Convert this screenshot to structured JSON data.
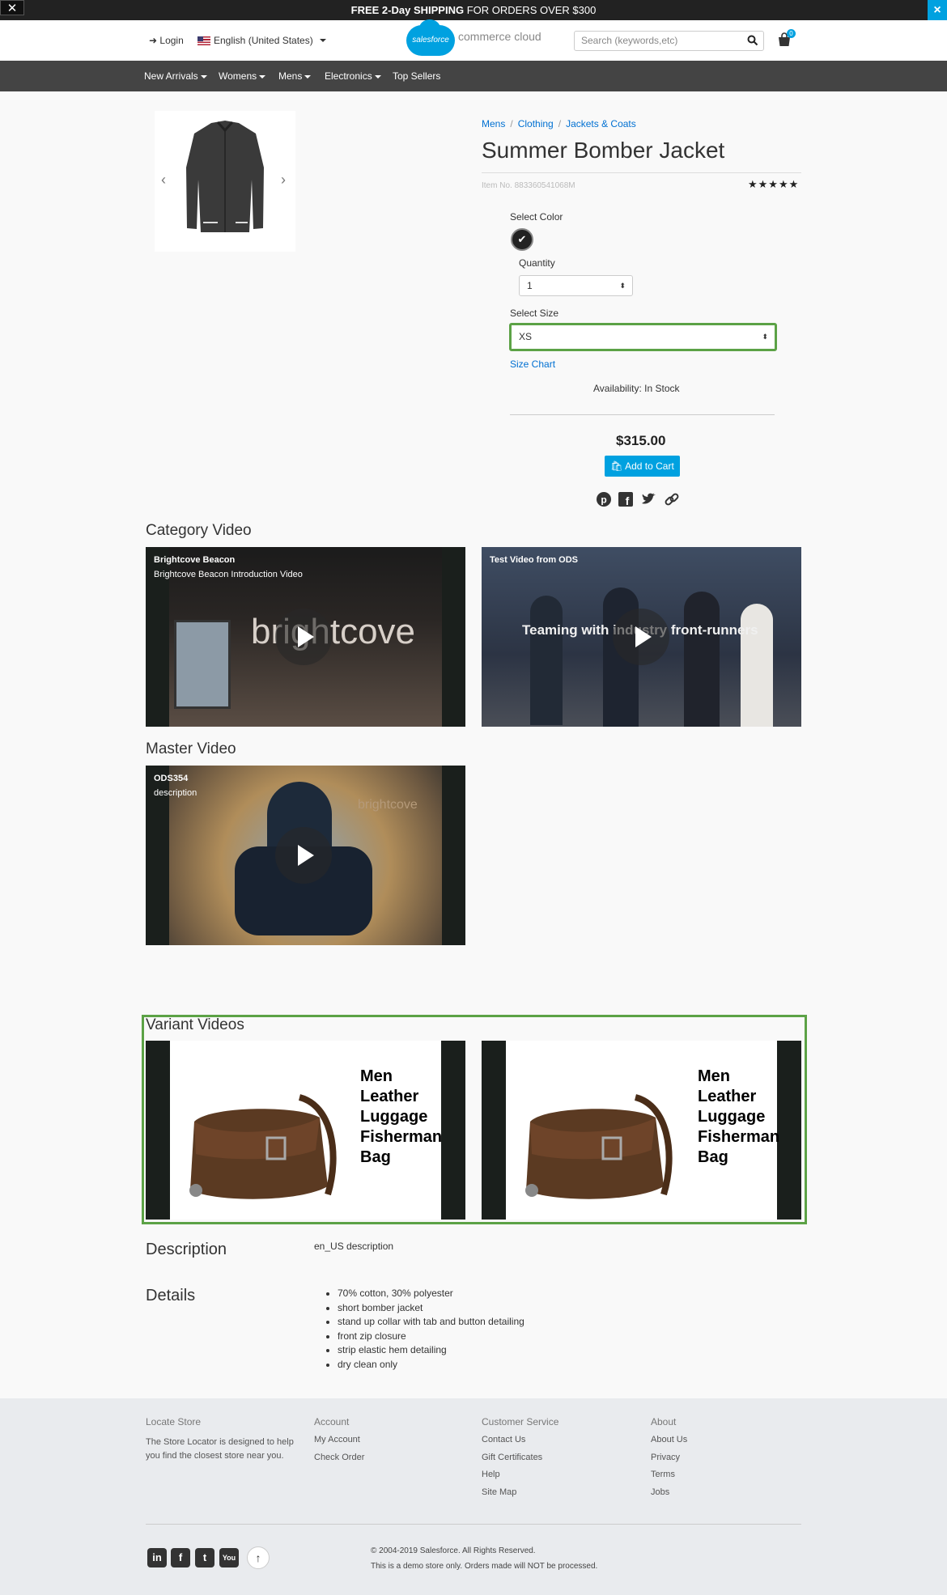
{
  "promo": {
    "bold": "FREE 2-Day SHIPPING",
    "rest": " FOR ORDERS OVER $300",
    "close": "×"
  },
  "header": {
    "login": "Login",
    "language": "English (United States)",
    "logo_badge": "salesforce",
    "logo_text": "commerce cloud",
    "search_placeholder": "Search (keywords,etc)",
    "cart_count": "0"
  },
  "nav": [
    "New Arrivals",
    "Womens",
    "Mens",
    "Electronics",
    "Top Sellers"
  ],
  "product": {
    "breadcrumb": [
      "Mens",
      "Clothing",
      "Jackets & Coats"
    ],
    "title": "Summer Bomber Jacket",
    "item_no": "Item No. 883360541068M",
    "rating_stars": 5,
    "stars_text": "★★★★★",
    "select_color_label": "Select Color",
    "quantity_label": "Quantity",
    "quantity_value": "1",
    "select_size_label": "Select Size",
    "size_value": "XS",
    "size_chart": "Size Chart",
    "availability": "Availability: In Stock",
    "price": "$315.00",
    "add_to_cart": "Add to Cart"
  },
  "category_video": {
    "heading": "Category Video",
    "videos": [
      {
        "title": "Brightcove Beacon",
        "desc": "Brightcove Beacon Introduction Video",
        "overlay": "brightcove"
      },
      {
        "title": "Test Video from ODS",
        "desc": "",
        "overlay": "Teaming with industry front-runners"
      }
    ]
  },
  "master_video": {
    "heading": "Master Video",
    "video": {
      "title": "ODS354",
      "desc": "description",
      "overlay": "brightcove"
    }
  },
  "variant_videos": {
    "heading": "Variant Videos",
    "bag_text": [
      "Men",
      "Leather",
      "Luggage",
      "Fisherman",
      "Bag"
    ]
  },
  "description": {
    "heading": "Description",
    "text": "en_US description"
  },
  "details": {
    "heading": "Details",
    "items": [
      "70% cotton, 30% polyester",
      "short bomber jacket",
      "stand up collar with tab and button detailing",
      "front zip closure",
      "strip elastic hem detailing",
      "dry clean only"
    ]
  },
  "footer": {
    "locate_title": "Locate Store",
    "locate_text_1": "The Store Locator is designed to help",
    "locate_text_2": "you find the closest store near you.",
    "account_title": "Account",
    "account_links": [
      "My Account",
      "Check Order"
    ],
    "service_title": "Customer Service",
    "service_links": [
      "Contact Us",
      "Gift Certificates",
      "Help",
      "Site Map"
    ],
    "about_title": "About",
    "about_links": [
      "About Us",
      "Privacy",
      "Terms",
      "Jobs"
    ],
    "copyright": "© 2004-2019 Salesforce. All Rights Reserved.",
    "demo_note": "This is a demo store only. Orders made will NOT be processed."
  },
  "colors": {
    "accent": "#00a1e0",
    "highlight": "#5ca246",
    "nav_bg": "#444444",
    "link": "#0070d2"
  }
}
